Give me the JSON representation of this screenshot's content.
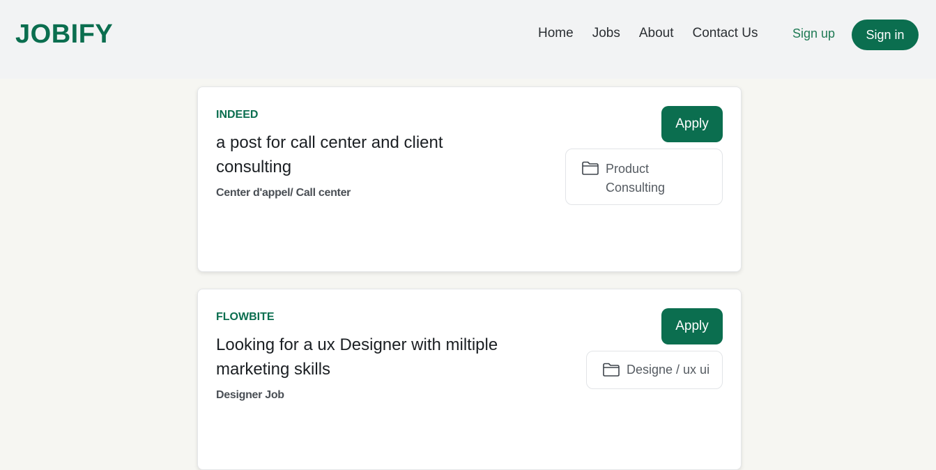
{
  "brand": {
    "logo": "JOBIFY",
    "accent": "#0b6e4f"
  },
  "nav": {
    "links": [
      "Home",
      "Jobs",
      "About",
      "Contact Us"
    ],
    "signup": "Sign up",
    "signin": "Sign in"
  },
  "jobs": [
    {
      "company": "INDEED",
      "title": "a post for call center and client consulting",
      "subtitle": "Center d'appel/ Call center",
      "apply_label": "Apply",
      "category": "Product Consulting",
      "category_icon": "folder-icon"
    },
    {
      "company": "FLOWBITE",
      "title": "Looking for a ux Designer with miltiple marketing skills",
      "subtitle": "Designer Job",
      "apply_label": "Apply",
      "category": "Designe / ux ui",
      "category_icon": "folder-icon"
    }
  ]
}
